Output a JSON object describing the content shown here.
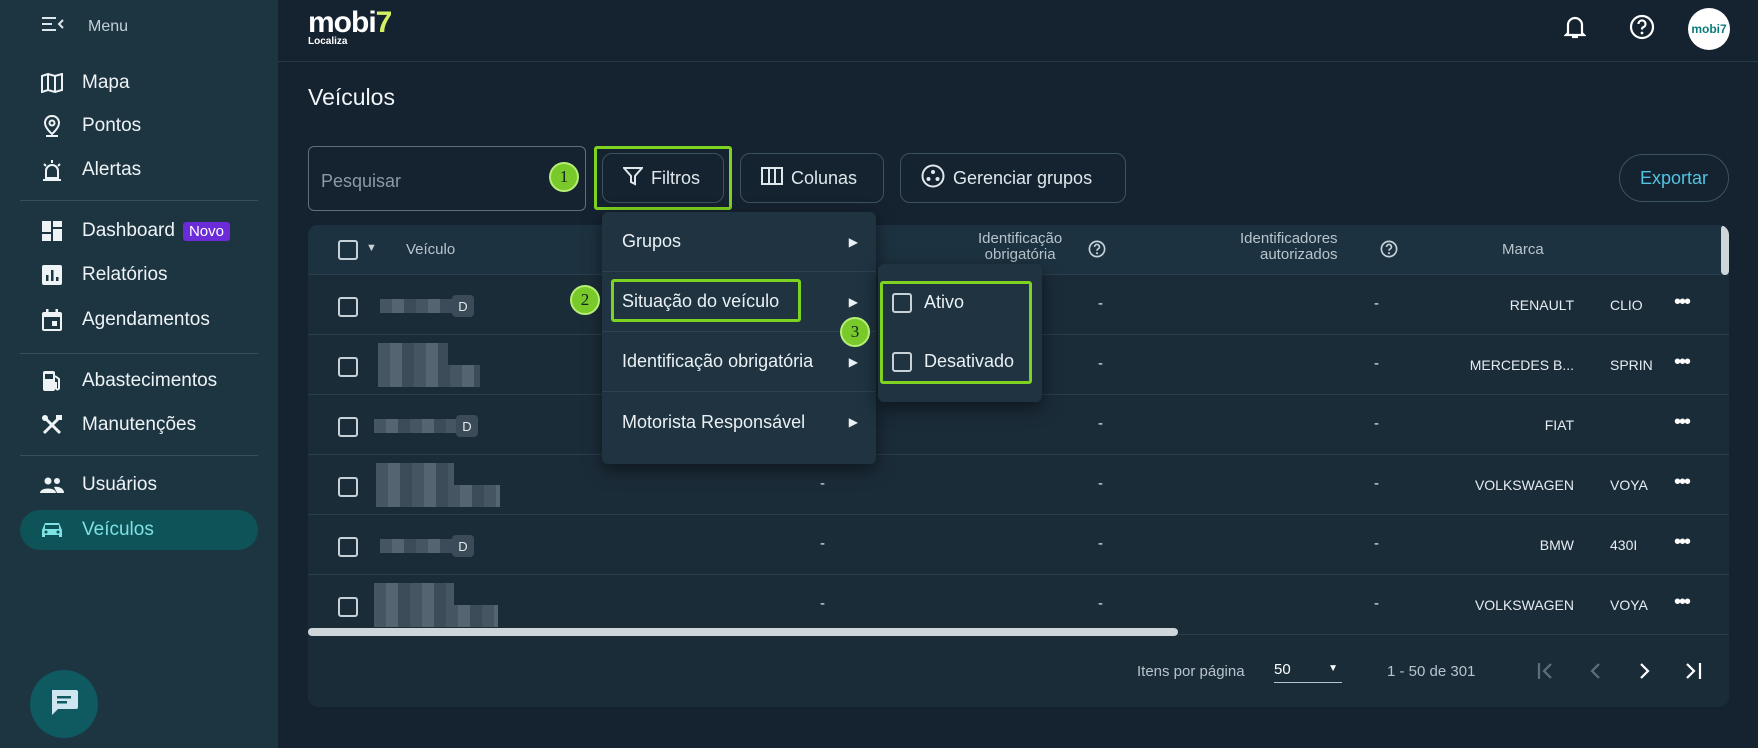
{
  "sidebar": {
    "menu_label": "Menu",
    "items": [
      {
        "label": "Mapa",
        "icon": "map-icon"
      },
      {
        "label": "Pontos",
        "icon": "location-pin-icon"
      },
      {
        "label": "Alertas",
        "icon": "alarm-icon"
      },
      {
        "label": "Dashboard",
        "icon": "dashboard-icon",
        "badge": "Novo"
      },
      {
        "label": "Relatórios",
        "icon": "report-icon"
      },
      {
        "label": "Agendamentos",
        "icon": "calendar-icon"
      },
      {
        "label": "Abastecimentos",
        "icon": "fuel-icon"
      },
      {
        "label": "Manutenções",
        "icon": "tools-icon"
      },
      {
        "label": "Usuários",
        "icon": "users-icon"
      },
      {
        "label": "Veículos",
        "icon": "car-icon",
        "active": true
      }
    ]
  },
  "header": {
    "logo_brand": "mobi",
    "logo_accent": "7",
    "logo_sub": "Localiza",
    "avatar_text": "mobi7"
  },
  "page": {
    "title": "Veículos"
  },
  "toolbar": {
    "search_placeholder": "Pesquisar",
    "filters_label": "Filtros",
    "columns_label": "Colunas",
    "groups_label": "Gerenciar grupos",
    "export_label": "Exportar"
  },
  "steps": [
    "1",
    "2",
    "3"
  ],
  "table": {
    "headers": {
      "vehicle": "Veículo",
      "required_id_1": "Identificação",
      "required_id_2": "obrigatória",
      "authorized_1": "Identificadores",
      "authorized_2": "autorizados",
      "brand": "Marca"
    },
    "rows": [
      {
        "tag": "D",
        "col2": "",
        "col3": "-",
        "col4": "-",
        "brand": "RENAULT",
        "model": "CLIO"
      },
      {
        "tag": "",
        "col2": "",
        "col3": "-",
        "col4": "-",
        "brand": "MERCEDES B...",
        "model": "SPRIN"
      },
      {
        "tag": "D",
        "col2": "",
        "col3": "-",
        "col4": "-",
        "brand": "FIAT",
        "model": ""
      },
      {
        "tag": "",
        "col2": "-",
        "col3": "-",
        "col4": "-",
        "brand": "VOLKSWAGEN",
        "model": "VOYA"
      },
      {
        "tag": "D",
        "col2": "-",
        "col3": "-",
        "col4": "-",
        "brand": "BMW",
        "model": "430I"
      },
      {
        "tag": "",
        "col2": "-",
        "col3": "-",
        "col4": "-",
        "brand": "VOLKSWAGEN",
        "model": "VOYA"
      }
    ]
  },
  "pagination": {
    "items_per_page_label": "Itens por página",
    "items_per_page_value": "50",
    "range": "1 - 50 de 301"
  },
  "filter_menu": {
    "items": [
      "Grupos",
      "Situação do veículo",
      "Identificação obrigatória",
      "Motorista Responsável"
    ]
  },
  "status_submenu": {
    "options": [
      "Ativo",
      "Desativado"
    ]
  }
}
